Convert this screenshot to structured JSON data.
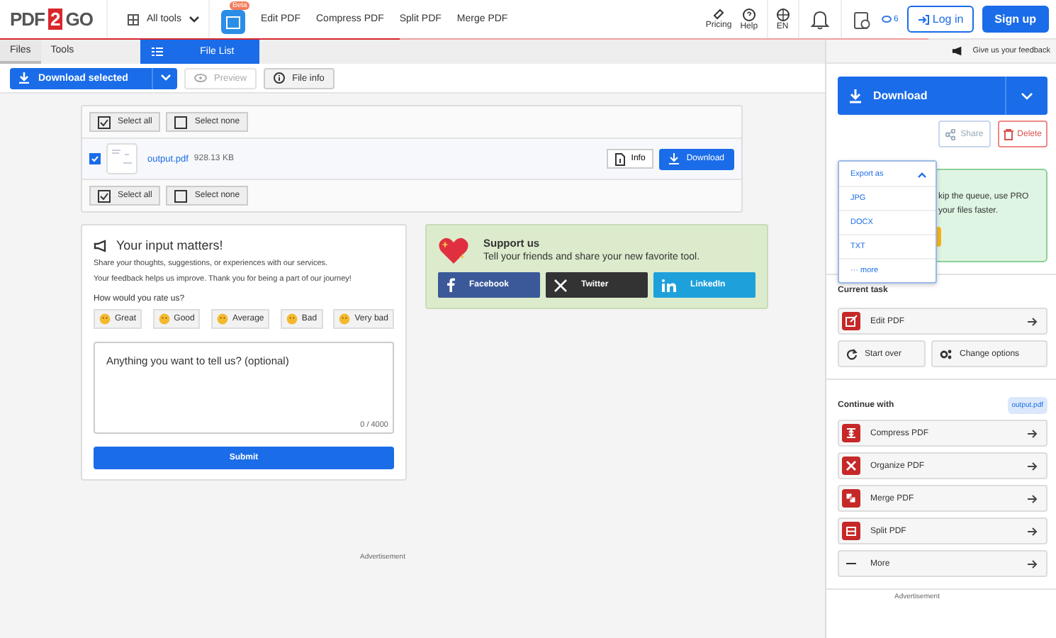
{
  "header": {
    "logo": {
      "left": "PDF",
      "mark": "2",
      "right": "GO"
    },
    "all_tools": "All tools",
    "beta_badge": "Beta",
    "nav": [
      "Edit PDF",
      "Compress PDF",
      "Split PDF",
      "Merge PDF"
    ],
    "pricing": "Pricing",
    "help": "Help",
    "language": "EN",
    "credits": "6",
    "login": "Log in",
    "signup": "Sign up",
    "progress": {
      "level": 0.43
    }
  },
  "tabs": [
    {
      "label": "Files",
      "selected": true
    },
    {
      "label": "Tools",
      "selected": false
    }
  ],
  "view_tab": {
    "label": "File List",
    "selected": true
  },
  "toolbar": {
    "download_selected": "Download selected",
    "preview": {
      "label": "Preview",
      "disabled": true
    },
    "file_info": {
      "label": "File info",
      "disabled": false
    }
  },
  "file_list": {
    "top_select": {
      "select_all": "Select all",
      "select_none": "Select none"
    },
    "files": [
      {
        "name": "output.pdf",
        "size": "928.13 KB",
        "checked": true,
        "info": "Info",
        "download": "Download"
      }
    ],
    "bottom_select": {
      "select_all": "Select all",
      "select_none": "Select none"
    }
  },
  "feedback": {
    "title": "Your input matters!",
    "lines": [
      "Share your thoughts, suggestions, or experiences with our services.",
      "Your feedback helps us improve. Thank you for being a part of our journey!"
    ],
    "question": "How would you rate us?",
    "ratings": [
      {
        "label": "Great",
        "selected": false
      },
      {
        "label": "Good",
        "selected": false
      },
      {
        "label": "Average",
        "selected": false
      },
      {
        "label": "Bad",
        "selected": false
      },
      {
        "label": "Very bad",
        "selected": false
      }
    ],
    "placeholder": "Anything you want to tell us? (optional)",
    "counter": "0 / 4000",
    "submit": "Submit"
  },
  "support": {
    "title": "Support us",
    "text": "Tell your friends and share your new favorite tool.",
    "shares": [
      {
        "kind": "facebook",
        "label": "Facebook",
        "color": "#3b5998"
      },
      {
        "kind": "twitter",
        "label": "Twitter",
        "color": "#333333"
      },
      {
        "kind": "linkedin",
        "label": "LinkedIn",
        "color": "#1ea1db"
      }
    ]
  },
  "advertisement": "Advertisement",
  "sidebar": {
    "feedback": "Give us your feedback",
    "download": "Download",
    "share": "Share",
    "delete": "Delete",
    "export": {
      "label": "Export as",
      "expanded": true,
      "options": [
        "JPG",
        "DOCX",
        "TXT",
        "··· more"
      ]
    },
    "premium": {
      "lines": [
        "kip the queue, use PRO",
        "your files faster."
      ]
    },
    "current_task": {
      "title": "Current task",
      "task": "Edit PDF",
      "start_over": "Start over",
      "change_options": "Change options"
    },
    "continue": {
      "title": "Continue with",
      "file": "output.pdf",
      "tools": [
        {
          "kind": "compress",
          "label": "Compress PDF"
        },
        {
          "kind": "organize",
          "label": "Organize PDF"
        },
        {
          "kind": "merge",
          "label": "Merge PDF"
        },
        {
          "kind": "split",
          "label": "Split PDF"
        },
        {
          "kind": "more",
          "label": "More"
        }
      ]
    },
    "advertisement": "Advertisement"
  }
}
